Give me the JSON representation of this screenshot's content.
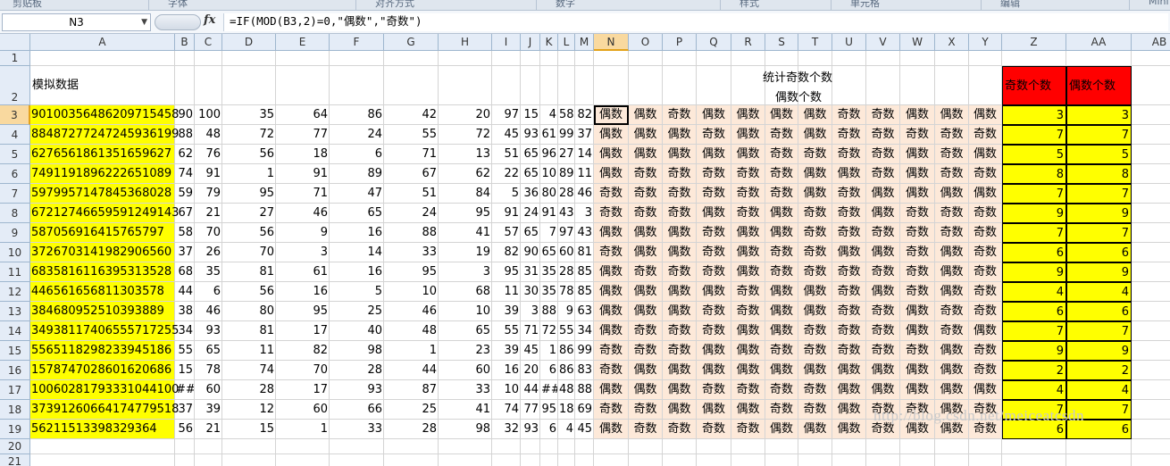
{
  "ribbon": {
    "groups": [
      "剪贴板",
      "字体",
      "对齐方式",
      "数字",
      "样式",
      "单元格",
      "编辑",
      "Mini"
    ]
  },
  "formula_bar": {
    "name_box": "N3",
    "fx_label": "fx",
    "formula": "=IF(MOD(B3,2)=0,\"偶数\",\"奇数\")"
  },
  "columns": [
    "A",
    "B",
    "C",
    "D",
    "E",
    "F",
    "G",
    "H",
    "I",
    "J",
    "K",
    "L",
    "M",
    "N",
    "O",
    "P",
    "Q",
    "R",
    "S",
    "T",
    "U",
    "V",
    "W",
    "X",
    "Y",
    "Z",
    "AA",
    "AB"
  ],
  "selected_cell": {
    "column": "N",
    "row": 3
  },
  "header_row": {
    "A": "模拟数据",
    "title_line1": "统计奇数个数",
    "title_line2": "偶数个数",
    "Z": "奇数个数",
    "AA": "偶数个数"
  },
  "colors": {
    "yellow": "#ffff00",
    "peach": "#fde9d9",
    "red": "#ff0000",
    "selection": "#f9d99f"
  },
  "rows": [
    {
      "r": "3",
      "a": "90100356486209715458",
      "v": [
        "90",
        "100",
        "35",
        "64",
        "86",
        "42",
        "20",
        "97",
        "15",
        "4",
        "58",
        "82"
      ],
      "p": [
        "偶数",
        "偶数",
        "奇数",
        "偶数",
        "偶数",
        "偶数",
        "偶数",
        "奇数",
        "奇数",
        "偶数",
        "偶数",
        "偶数"
      ],
      "z": "3",
      "aa": "3"
    },
    {
      "r": "4",
      "a": "88487277247245936199",
      "v": [
        "88",
        "48",
        "72",
        "77",
        "24",
        "55",
        "72",
        "45",
        "93",
        "61",
        "99",
        "37"
      ],
      "p": [
        "偶数",
        "偶数",
        "偶数",
        "奇数",
        "偶数",
        "奇数",
        "偶数",
        "奇数",
        "奇数",
        "奇数",
        "奇数",
        "奇数"
      ],
      "z": "7",
      "aa": "7"
    },
    {
      "r": "5",
      "a": "627656186135165962​7",
      "v": [
        "62",
        "76",
        "56",
        "18",
        "6",
        "71",
        "13",
        "51",
        "65",
        "96",
        "27",
        "14"
      ],
      "p": [
        "偶数",
        "偶数",
        "偶数",
        "偶数",
        "偶数",
        "奇数",
        "奇数",
        "奇数",
        "奇数",
        "偶数",
        "奇数",
        "偶数"
      ],
      "z": "5",
      "aa": "5"
    },
    {
      "r": "6",
      "a": "7491191896222651089",
      "v": [
        "74",
        "91",
        "1",
        "91",
        "89",
        "67",
        "62",
        "22",
        "65",
        "10",
        "89",
        "11"
      ],
      "p": [
        "偶数",
        "奇数",
        "奇数",
        "奇数",
        "奇数",
        "奇数",
        "偶数",
        "偶数",
        "奇数",
        "偶数",
        "奇数",
        "奇数"
      ],
      "z": "8",
      "aa": "8"
    },
    {
      "r": "7",
      "a": "597995714784536802​8",
      "v": [
        "59",
        "79",
        "95",
        "71",
        "47",
        "51",
        "84",
        "5",
        "36",
        "80",
        "28",
        "46"
      ],
      "p": [
        "奇数",
        "奇数",
        "奇数",
        "奇数",
        "奇数",
        "奇数",
        "偶数",
        "奇数",
        "偶数",
        "偶数",
        "偶数",
        "偶数"
      ],
      "z": "7",
      "aa": "7"
    },
    {
      "r": "8",
      "a": "67212746659591249143",
      "v": [
        "67",
        "21",
        "27",
        "46",
        "65",
        "24",
        "95",
        "91",
        "24",
        "91",
        "43",
        "3"
      ],
      "p": [
        "奇数",
        "奇数",
        "奇数",
        "偶数",
        "奇数",
        "偶数",
        "奇数",
        "奇数",
        "偶数",
        "奇数",
        "奇数",
        "奇数"
      ],
      "z": "9",
      "aa": "9"
    },
    {
      "r": "9",
      "a": "587056916415765797",
      "v": [
        "58",
        "70",
        "56",
        "9",
        "16",
        "88",
        "41",
        "57",
        "65",
        "7",
        "97",
        "43"
      ],
      "p": [
        "偶数",
        "偶数",
        "偶数",
        "奇数",
        "偶数",
        "偶数",
        "奇数",
        "奇数",
        "奇数",
        "奇数",
        "奇数",
        "奇数"
      ],
      "z": "7",
      "aa": "7"
    },
    {
      "r": "10",
      "a": "3726703141982906560",
      "v": [
        "37",
        "26",
        "70",
        "3",
        "14",
        "33",
        "19",
        "82",
        "90",
        "65",
        "60",
        "81"
      ],
      "p": [
        "奇数",
        "偶数",
        "偶数",
        "奇数",
        "偶数",
        "奇数",
        "奇数",
        "偶数",
        "偶数",
        "奇数",
        "偶数",
        "奇数"
      ],
      "z": "6",
      "aa": "6"
    },
    {
      "r": "11",
      "a": "6835816116395313528",
      "v": [
        "68",
        "35",
        "81",
        "61",
        "16",
        "95",
        "3",
        "95",
        "31",
        "35",
        "28",
        "85"
      ],
      "p": [
        "偶数",
        "奇数",
        "奇数",
        "奇数",
        "偶数",
        "奇数",
        "奇数",
        "奇数",
        "奇数",
        "奇数",
        "偶数",
        "奇数"
      ],
      "z": "9",
      "aa": "9"
    },
    {
      "r": "12",
      "a": "446561656811303578",
      "v": [
        "44",
        "6",
        "56",
        "16",
        "5",
        "10",
        "68",
        "11",
        "30",
        "35",
        "78",
        "85"
      ],
      "p": [
        "偶数",
        "偶数",
        "偶数",
        "偶数",
        "奇数",
        "偶数",
        "偶数",
        "奇数",
        "偶数",
        "奇数",
        "偶数",
        "奇数"
      ],
      "z": "4",
      "aa": "4"
    },
    {
      "r": "13",
      "a": "384680952510393889",
      "v": [
        "38",
        "46",
        "80",
        "95",
        "25",
        "46",
        "10",
        "39",
        "3",
        "88",
        "9",
        "63"
      ],
      "p": [
        "偶数",
        "偶数",
        "偶数",
        "奇数",
        "奇数",
        "偶数",
        "偶数",
        "奇数",
        "奇数",
        "偶数",
        "奇数",
        "奇数"
      ],
      "z": "6",
      "aa": "6"
    },
    {
      "r": "14",
      "a": "34938117406555717255",
      "v": [
        "34",
        "93",
        "81",
        "17",
        "40",
        "48",
        "65",
        "55",
        "71",
        "72",
        "55",
        "34"
      ],
      "p": [
        "偶数",
        "奇数",
        "奇数",
        "奇数",
        "偶数",
        "偶数",
        "奇数",
        "奇数",
        "奇数",
        "偶数",
        "奇数",
        "偶数"
      ],
      "z": "7",
      "aa": "7"
    },
    {
      "r": "15",
      "a": "5565118298233945186",
      "v": [
        "55",
        "65",
        "11",
        "82",
        "98",
        "1",
        "23",
        "39",
        "45",
        "1",
        "86",
        "99"
      ],
      "p": [
        "奇数",
        "奇数",
        "奇数",
        "偶数",
        "偶数",
        "奇数",
        "奇数",
        "奇数",
        "奇数",
        "奇数",
        "偶数",
        "奇数"
      ],
      "z": "9",
      "aa": "9"
    },
    {
      "r": "16",
      "a": "1578747028601620686",
      "v": [
        "15",
        "78",
        "74",
        "70",
        "28",
        "44",
        "60",
        "16",
        "20",
        "6",
        "86",
        "83"
      ],
      "p": [
        "奇数",
        "偶数",
        "偶数",
        "偶数",
        "偶数",
        "偶数",
        "偶数",
        "偶数",
        "偶数",
        "偶数",
        "偶数",
        "奇数"
      ],
      "z": "2",
      "aa": "2"
    },
    {
      "r": "17",
      "a": "10060281793331044100",
      "v": [
        "##",
        "60",
        "28",
        "17",
        "93",
        "87",
        "33",
        "10",
        "44",
        "##",
        "48",
        "88"
      ],
      "p": [
        "偶数",
        "偶数",
        "偶数",
        "奇数",
        "奇数",
        "奇数",
        "奇数",
        "偶数",
        "偶数",
        "偶数",
        "偶数",
        "偶数"
      ],
      "z": "4",
      "aa": "4"
    },
    {
      "r": "18",
      "a": "3739126066417477951​8",
      "v": [
        "37",
        "39",
        "12",
        "60",
        "66",
        "25",
        "41",
        "74",
        "77",
        "95",
        "18",
        "69"
      ],
      "p": [
        "奇数",
        "奇数",
        "偶数",
        "偶数",
        "偶数",
        "奇数",
        "奇数",
        "偶数",
        "奇数",
        "奇数",
        "偶数",
        "奇数"
      ],
      "z": "7",
      "aa": "7"
    },
    {
      "r": "19",
      "a": "56211513398329364",
      "v": [
        "56",
        "21",
        "15",
        "1",
        "33",
        "28",
        "98",
        "32",
        "93",
        "6",
        "4",
        "45"
      ],
      "p": [
        "偶数",
        "奇数",
        "奇数",
        "奇数",
        "奇数",
        "偶数",
        "偶数",
        "偶数",
        "奇数",
        "偶数",
        "偶数",
        "奇数"
      ],
      "z": "6",
      "aa": "6"
    }
  ],
  "empty_rows": [
    "1",
    "20",
    "21"
  ],
  "watermark": "http://blog.csdn.net/meiceatcsdn"
}
